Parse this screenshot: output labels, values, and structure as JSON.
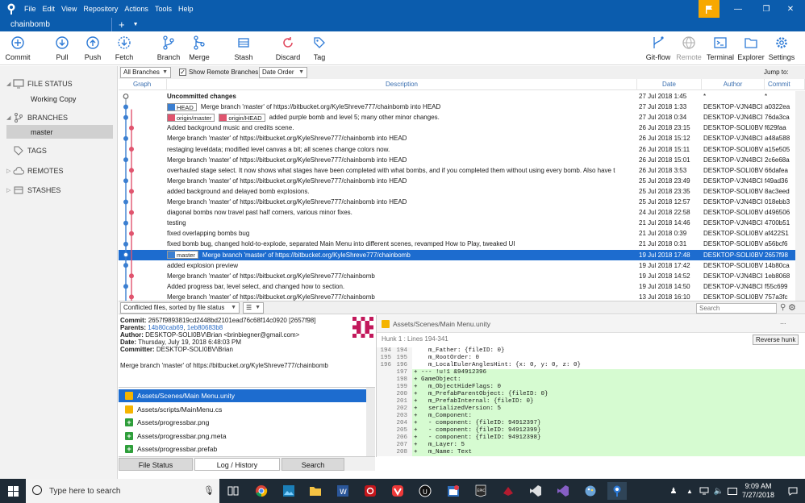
{
  "menubar": {
    "items": [
      "File",
      "Edit",
      "View",
      "Repository",
      "Actions",
      "Tools",
      "Help"
    ]
  },
  "tabs": [
    {
      "label": "chainbomb"
    }
  ],
  "toolbar": {
    "left": [
      "Commit",
      "Pull",
      "Push",
      "Fetch",
      "Branch",
      "Merge",
      "Stash",
      "Discard",
      "Tag"
    ],
    "right": [
      "Git-flow",
      "Remote",
      "Terminal",
      "Explorer",
      "Settings"
    ]
  },
  "sidebar": {
    "file_status": "FILE STATUS",
    "working_copy": "Working Copy",
    "branches": "BRANCHES",
    "master": "master",
    "tags": "TAGS",
    "remotes": "REMOTES",
    "stashes": "STASHES"
  },
  "filterbar": {
    "branches": "All Branches",
    "show_remote": "Show Remote Branches",
    "order": "Date Order",
    "jump": "Jump to:"
  },
  "columns": {
    "graph": "Graph",
    "description": "Description",
    "date": "Date",
    "author": "Author",
    "commit": "Commit"
  },
  "commits": [
    {
      "desc": "Uncommitted changes",
      "date": "27 Jul 2018 1:45",
      "author": "*",
      "hash": "*",
      "bold": true
    },
    {
      "desc": "Merge branch 'master' of https://bitbucket.org/KyleShreve777/chainbomb into HEAD",
      "date": "27 Jul 2018 1:33",
      "author": "DESKTOP-VJN4BCI",
      "hash": "a0322ea",
      "tags": [
        "HEAD"
      ]
    },
    {
      "desc": "added purple bomb and level 5; many other minor changes.",
      "date": "27 Jul 2018 0:34",
      "author": "DESKTOP-VJN4BCI",
      "hash": "76da3ca",
      "tags": [
        "origin/master",
        "origin/HEAD"
      ]
    },
    {
      "desc": "Added background music and credits scene.",
      "date": "26 Jul 2018 23:15",
      "author": "DESKTOP-SOLI0BV",
      "hash": "f629faa"
    },
    {
      "desc": "Merge branch 'master' of https://bitbucket.org/KyleShreve777/chainbomb into HEAD",
      "date": "26 Jul 2018 15:12",
      "author": "DESKTOP-VJN4BCI",
      "hash": "a48a588"
    },
    {
      "desc": "restaging leveldata; modified level canvas a bit; all scenes change colors now.",
      "date": "26 Jul 2018 15:11",
      "author": "DESKTOP-SOLI0BV",
      "hash": "a15e505"
    },
    {
      "desc": "Merge branch 'master' of https://bitbucket.org/KyleShreve777/chainbomb into HEAD",
      "date": "26 Jul 2018 15:01",
      "author": "DESKTOP-VJN4BCI",
      "hash": "2c6e68a"
    },
    {
      "desc": "overhauled stage select. It now shows what stages have been completed with what bombs, and if you completed them without using every bomb. Also have t",
      "date": "26 Jul 2018 3:53",
      "author": "DESKTOP-SOLI0BV",
      "hash": "66dafea"
    },
    {
      "desc": "Merge branch 'master' of https://bitbucket.org/KyleShreve777/chainbomb into HEAD",
      "date": "25 Jul 2018 23:49",
      "author": "DESKTOP-VJN4BCI",
      "hash": "f49ad36"
    },
    {
      "desc": "added background and delayed bomb explosions.",
      "date": "25 Jul 2018 23:35",
      "author": "DESKTOP-SOLI0BV",
      "hash": "8ac3eed"
    },
    {
      "desc": "Merge branch 'master' of https://bitbucket.org/KyleShreve777/chainbomb into HEAD",
      "date": "25 Jul 2018 12:57",
      "author": "DESKTOP-VJN4BCI",
      "hash": "018ebb3"
    },
    {
      "desc": "diagonal bombs now travel past half corners, various minor fixes.",
      "date": "24 Jul 2018 22:58",
      "author": "DESKTOP-SOLI0BV",
      "hash": "d496506"
    },
    {
      "desc": "testing",
      "date": "21 Jul 2018 14:46",
      "author": "DESKTOP-VJN4BCI",
      "hash": "4700b51"
    },
    {
      "desc": "fixed overlapping bombs bug",
      "date": "21 Jul 2018 0:39",
      "author": "DESKTOP-SOLI0BV",
      "hash": "af422S1"
    },
    {
      "desc": "fixed bomb bug, changed hold-to-explode, separated Main Menu into different scenes, revamped How to Play, tweaked UI",
      "date": "21 Jul 2018 0:31",
      "author": "DESKTOP-SOLI0BV",
      "hash": "a56bcf6"
    },
    {
      "desc": "Merge branch 'master' of https://bitbucket.org/KyleShreve777/chainbomb",
      "date": "19 Jul 2018 17:48",
      "author": "DESKTOP-SOLI0BV",
      "hash": "2657f98",
      "tags": [
        "master"
      ],
      "selected": true
    },
    {
      "desc": "added explosion preview",
      "date": "19 Jul 2018 17:42",
      "author": "DESKTOP-SOLI0BV",
      "hash": "14b80ca"
    },
    {
      "desc": "Merge branch 'master' of https://bitbucket.org/KyleShreve777/chainbomb",
      "date": "19 Jul 2018 14:52",
      "author": "DESKTOP-VJN4BCI",
      "hash": "1eb8068"
    },
    {
      "desc": "Added progress bar, level select, and changed how to section.",
      "date": "19 Jul 2018 14:50",
      "author": "DESKTOP-VJN4BCI",
      "hash": "f55c699"
    },
    {
      "desc": "Merge branch 'master' of https://bitbucket.org/KyleShreve777/chainbomb",
      "date": "13 Jul 2018 16:10",
      "author": "DESKTOP-SOLI0BV",
      "hash": "757a3fc"
    }
  ],
  "bottombar": {
    "sort": "Conflicted files, sorted by file status",
    "search_placeholder": "Search"
  },
  "details": {
    "commit_label": "Commit:",
    "commit_value": "2657f9893819cd2448bd2101ead76c68f14c0920 [2657f98]",
    "parents_label": "Parents:",
    "parent1": "14b80cab69",
    "parent2": "1eb80683b8",
    "author_label": "Author:",
    "author_value": "DESKTOP-SOLI0BV\\Brian <brinbiegner@gmail.com>",
    "date_label": "Date:",
    "date_value": "Thursday, July 19, 2018 6:48:03 PM",
    "committer_label": "Committer:",
    "committer_value": "DESKTOP-SOLI0BV\\Brian",
    "message": "Merge branch 'master' of https://bitbucket.org/KyleShreve777/chainbomb"
  },
  "files": [
    {
      "name": "Assets/Scenes/Main Menu.unity",
      "status": "modified",
      "selected": true
    },
    {
      "name": "Assets/scripts/MainMenu.cs",
      "status": "modified"
    },
    {
      "name": "Assets/progressbar.png",
      "status": "added"
    },
    {
      "name": "Assets/progressbar.png.meta",
      "status": "added"
    },
    {
      "name": "Assets/progressbar.prefab",
      "status": "added"
    }
  ],
  "bottom_tabs": [
    "File Status",
    "Log / History",
    "Search"
  ],
  "diff": {
    "file": "Assets/Scenes/Main Menu.unity",
    "hunk": "Hunk 1 : Lines 194-341",
    "reverse": "Reverse hunk",
    "more": "...",
    "lines": [
      {
        "o": "194",
        "n": "194",
        "t": "    m_Father: {fileID: 0}",
        "add": false
      },
      {
        "o": "195",
        "n": "195",
        "t": "    m_RootOrder: 0",
        "add": false
      },
      {
        "o": "196",
        "n": "196",
        "t": "    m_LocalEulerAnglesHint: {x: 0, y: 0, z: 0}",
        "add": false
      },
      {
        "o": "",
        "n": "197",
        "t": "+ --- !u!1 &94912396",
        "add": true
      },
      {
        "o": "",
        "n": "198",
        "t": "+ GameObject:",
        "add": true
      },
      {
        "o": "",
        "n": "199",
        "t": "+   m_ObjectHideFlags: 0",
        "add": true
      },
      {
        "o": "",
        "n": "200",
        "t": "+   m_PrefabParentObject: {fileID: 0}",
        "add": true
      },
      {
        "o": "",
        "n": "201",
        "t": "+   m_PrefabInternal: {fileID: 0}",
        "add": true
      },
      {
        "o": "",
        "n": "202",
        "t": "+   serializedVersion: 5",
        "add": true
      },
      {
        "o": "",
        "n": "203",
        "t": "+   m_Component:",
        "add": true
      },
      {
        "o": "",
        "n": "204",
        "t": "+   - component: {fileID: 94912397}",
        "add": true
      },
      {
        "o": "",
        "n": "205",
        "t": "+   - component: {fileID: 94912399}",
        "add": true
      },
      {
        "o": "",
        "n": "206",
        "t": "+   - component: {fileID: 94912398}",
        "add": true
      },
      {
        "o": "",
        "n": "207",
        "t": "+   m_Layer: 5",
        "add": true
      },
      {
        "o": "",
        "n": "208",
        "t": "+   m_Name: Text",
        "add": true
      }
    ]
  },
  "taskbar": {
    "search_placeholder": "Type here to search",
    "time": "9:09 AM",
    "date": "7/27/2018"
  },
  "colors": {
    "accent": "#0b5cad",
    "selection": "#1d6ccf",
    "graph_blue": "#3b7fd1",
    "graph_red": "#e0546e",
    "diff_add": "#d6fbd1"
  }
}
